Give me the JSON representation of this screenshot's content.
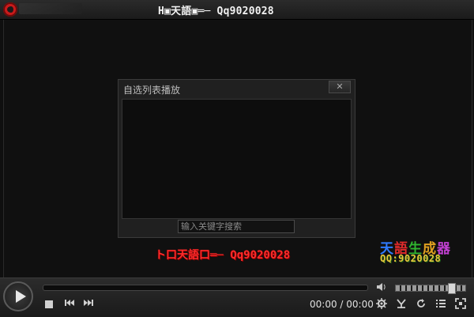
{
  "window": {
    "title": "H▣天語▣═─ Qq9020028"
  },
  "playlist": {
    "title": "自选列表播放",
    "close_label": "✕",
    "search_placeholder": "输入关键字搜索"
  },
  "overlay": {
    "red_text": "ト口天語口═─ Qq9020028",
    "logo_line1": [
      "天",
      "語",
      "生",
      "成",
      "器"
    ],
    "logo_line2": "QQ:9020028"
  },
  "controls": {
    "time": "00:00 / 00:00",
    "progress": 0,
    "volume": 0.8
  }
}
